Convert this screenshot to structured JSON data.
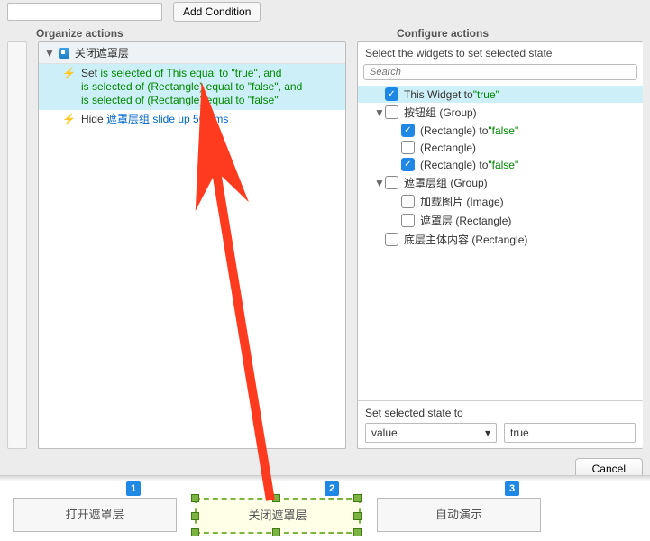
{
  "top": {
    "add_condition": "Add Condition"
  },
  "sections": {
    "organize": "Organize actions",
    "configure": "Configure actions"
  },
  "case": {
    "name": "关闭遮罩层"
  },
  "actions": {
    "set": {
      "verb": "Set",
      "d1": "is selected of This equal to \"true\", and",
      "d2": "is selected of (Rectangle) equal to \"false\", and",
      "d3": "is selected of (Rectangle) equal to \"false\""
    },
    "hide": {
      "verb": "Hide",
      "target": "遮罩层组",
      "anim": "slide up 500 ms"
    }
  },
  "configure": {
    "header": "Select the widgets to set selected state",
    "search_placeholder": "Search",
    "this_widget": "This Widget to ",
    "this_val": "\"true\"",
    "btn_group": "按钮组 (Group)",
    "rect_false1": "(Rectangle) to ",
    "rect_false1_val": "\"false\"",
    "rect_plain": "(Rectangle)",
    "rect_false2": "(Rectangle) to ",
    "rect_false2_val": "\"false\"",
    "mask_group": "遮罩层组 (Group)",
    "mask_img": "加载图片 (Image)",
    "mask_rect": "遮罩层 (Rectangle)",
    "bottom_rect": "底层主体内容 (Rectangle)",
    "set_state_label": "Set selected state to",
    "state_basis": "value",
    "state_value": "true"
  },
  "dialog": {
    "cancel": "Cancel"
  },
  "tabs": {
    "t1": "打开遮罩层",
    "t2": "关闭遮罩层",
    "t3": "自动演示",
    "b1": "1",
    "b2": "2",
    "b3": "3"
  }
}
